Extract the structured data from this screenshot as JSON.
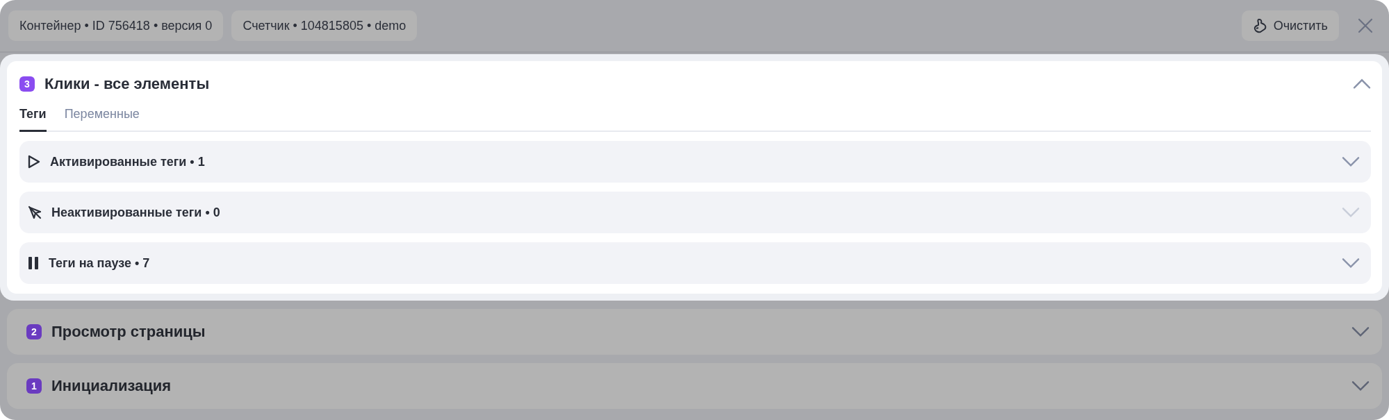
{
  "chips": [
    "Контейнер • ID 756418 • версия 0",
    "Счетчик • 104815805 • demo"
  ],
  "clear_button": "Очистить",
  "sections": [
    {
      "number": "3",
      "title": "Клики - все элементы",
      "expanded": true,
      "tabs": [
        {
          "label": "Теги",
          "selected": true
        },
        {
          "label": "Переменные",
          "selected": false
        }
      ],
      "groups": [
        {
          "kind": "play",
          "label": "Активированные теги • 1",
          "disabled": false
        },
        {
          "kind": "crossed",
          "label": "Неактивированные теги • 0",
          "disabled": true
        },
        {
          "kind": "pause",
          "label": "Теги на паузе • 7",
          "disabled": false
        }
      ]
    },
    {
      "number": "2",
      "title": "Просмотр страницы",
      "expanded": false
    },
    {
      "number": "1",
      "title": "Инициализация",
      "expanded": false
    }
  ]
}
